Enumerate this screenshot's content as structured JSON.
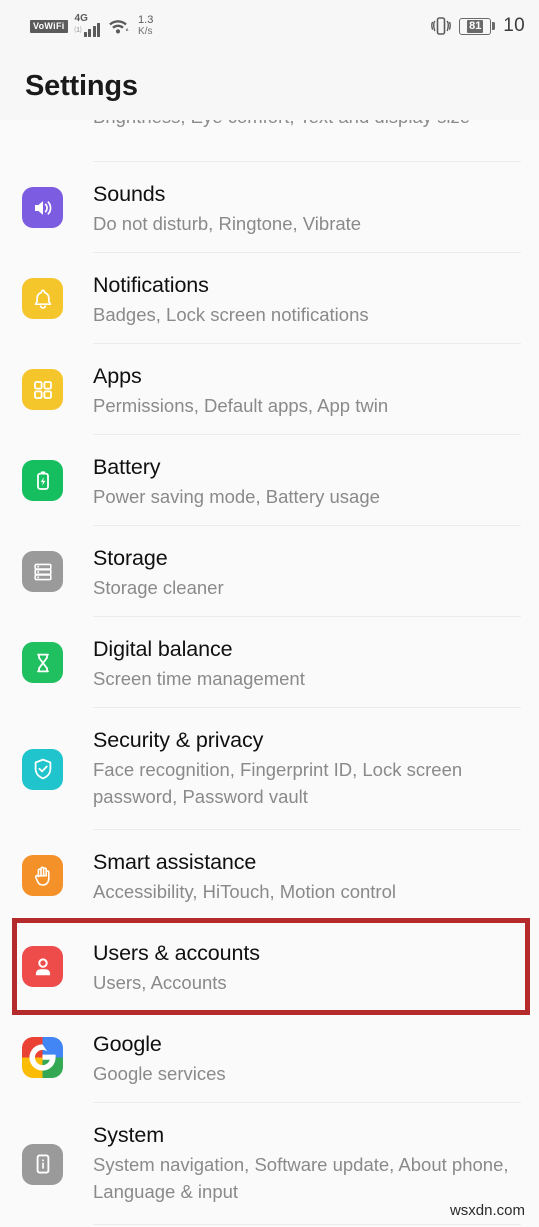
{
  "status_bar": {
    "vowifi_label": "VoWiFi",
    "network_type": "4G",
    "network_sub": "1)",
    "net_speed_value": "1.3",
    "net_speed_unit": "K/s",
    "battery_percent": "81",
    "clock": "10"
  },
  "header": {
    "title": "Settings"
  },
  "partial_row": {
    "subtitle": "Brightness, Eye comfort, Text and display size"
  },
  "items": [
    {
      "title": "Sounds",
      "subtitle": "Do not disturb, Ringtone, Vibrate",
      "icon": "speaker-icon",
      "icon_bg": "#7c5ce0"
    },
    {
      "title": "Notifications",
      "subtitle": "Badges, Lock screen notifications",
      "icon": "bell-icon",
      "icon_bg": "#f5c52c"
    },
    {
      "title": "Apps",
      "subtitle": "Permissions, Default apps, App twin",
      "icon": "grid-squares-icon",
      "icon_bg": "#f5c52c"
    },
    {
      "title": "Battery",
      "subtitle": "Power saving mode, Battery usage",
      "icon": "battery-bolt-icon",
      "icon_bg": "#15bf5f"
    },
    {
      "title": "Storage",
      "subtitle": "Storage cleaner",
      "icon": "storage-stack-icon",
      "icon_bg": "#9a9a9a"
    },
    {
      "title": "Digital balance",
      "subtitle": "Screen time management",
      "icon": "hourglass-icon",
      "icon_bg": "#20c060"
    },
    {
      "title": "Security & privacy",
      "subtitle": "Face recognition, Fingerprint ID, Lock screen password, Password vault",
      "icon": "shield-check-icon",
      "icon_bg": "#1fc4cc"
    },
    {
      "title": "Smart assistance",
      "subtitle": "Accessibility, HiTouch, Motion control",
      "icon": "hand-icon",
      "icon_bg": "#f59129"
    },
    {
      "title": "Users & accounts",
      "subtitle": "Users, Accounts",
      "icon": "person-icon",
      "icon_bg": "#ee4b4b",
      "highlighted": true
    },
    {
      "title": "Google",
      "subtitle": "Google services",
      "icon": "google-g-icon",
      "icon_bg": "#ffffff"
    },
    {
      "title": "System",
      "subtitle": "System navigation, Software update, About phone, Language & input",
      "icon": "phone-info-icon",
      "icon_bg": "#9a9a9a"
    }
  ],
  "highlight": {
    "color": "#b52b2b"
  },
  "watermark": "wsxdn.com"
}
